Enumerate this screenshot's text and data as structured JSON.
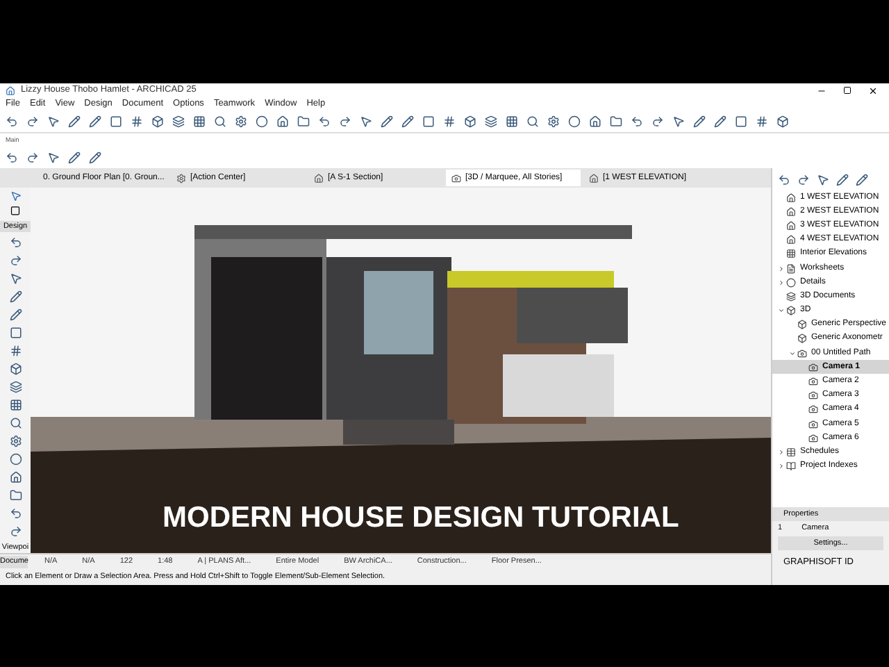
{
  "window": {
    "title": "Lizzy House Thobo Hamlet - ARCHICAD 25"
  },
  "menu": [
    "File",
    "Edit",
    "View",
    "Design",
    "Document",
    "Options",
    "Teamwork",
    "Window",
    "Help"
  ],
  "toolbar_label": "Main",
  "tabs": [
    {
      "label": "0. Ground Floor Plan [0. Groun...",
      "kind": "plan",
      "selected": false
    },
    {
      "label": "[Action Center]",
      "kind": "action",
      "selected": false
    },
    {
      "label": "[A S-1 Section]",
      "kind": "section",
      "selected": false
    },
    {
      "label": "[3D / Marquee, All Stories]",
      "kind": "view3d",
      "selected": true
    },
    {
      "label": "[1 WEST ELEVATION]",
      "kind": "elevation",
      "selected": false
    }
  ],
  "toolbox": {
    "label": "Design",
    "bottom_label": "Viewpoi"
  },
  "viewport": {
    "caption": "MODERN HOUSE DESIGN TUTORIAL"
  },
  "navigator": [
    {
      "label": "1 WEST ELEVATION",
      "kind": "elevation",
      "selected": false
    },
    {
      "label": "2 WEST ELEVATION",
      "kind": "elevation",
      "selected": false
    },
    {
      "label": "3 WEST ELEVATION",
      "kind": "elevation",
      "selected": false
    },
    {
      "label": "4 WEST ELEVATION",
      "kind": "elevation",
      "selected": false
    },
    {
      "label": "Interior Elevations",
      "kind": "interior",
      "selected": false
    },
    {
      "label": "Worksheets",
      "kind": "worksheet",
      "expanded": false,
      "selected": false
    },
    {
      "label": "Details",
      "kind": "detail",
      "expanded": false,
      "selected": false
    },
    {
      "label": "3D Documents",
      "kind": "doc3d",
      "selected": false
    },
    {
      "label": "3D",
      "kind": "cube",
      "expanded": true,
      "selected": false,
      "children": [
        {
          "label": "Generic Perspective",
          "kind": "cube",
          "selected": false
        },
        {
          "label": "Generic Axonometr",
          "kind": "cube",
          "selected": false
        },
        {
          "label": "00 Untitled Path",
          "kind": "path",
          "expanded": true,
          "selected": false,
          "children": [
            {
              "label": "Camera 1",
              "kind": "camera",
              "selected": true
            },
            {
              "label": "Camera 2",
              "kind": "camera",
              "selected": false
            },
            {
              "label": "Camera 3",
              "kind": "camera",
              "selected": false
            },
            {
              "label": "Camera 4",
              "kind": "camera",
              "selected": false
            },
            {
              "label": "Camera 5",
              "kind": "camera",
              "selected": false
            },
            {
              "label": "Camera 6",
              "kind": "camera",
              "selected": false
            }
          ]
        }
      ]
    },
    {
      "label": "Schedules",
      "kind": "schedule",
      "expanded": false,
      "selected": false
    },
    {
      "label": "Project Indexes",
      "kind": "index",
      "expanded": false,
      "selected": false
    }
  ],
  "properties": {
    "title": "Properties",
    "id": "1",
    "value": "Camera",
    "button": "Settings..."
  },
  "status_bar": {
    "label": "Docume",
    "fields": [
      "N/A",
      "N/A",
      "122",
      "1:48",
      "A | PLANS Aft...",
      "Entire Model",
      "BW ArchiCA...",
      "Construction...",
      "Floor Presen..."
    ],
    "hint": "Click an Element or Draw a Selection Area. Press and Hold Ctrl+Shift to Toggle Element/Sub-Element Selection."
  },
  "brand": "GRAPHISOFT ID"
}
